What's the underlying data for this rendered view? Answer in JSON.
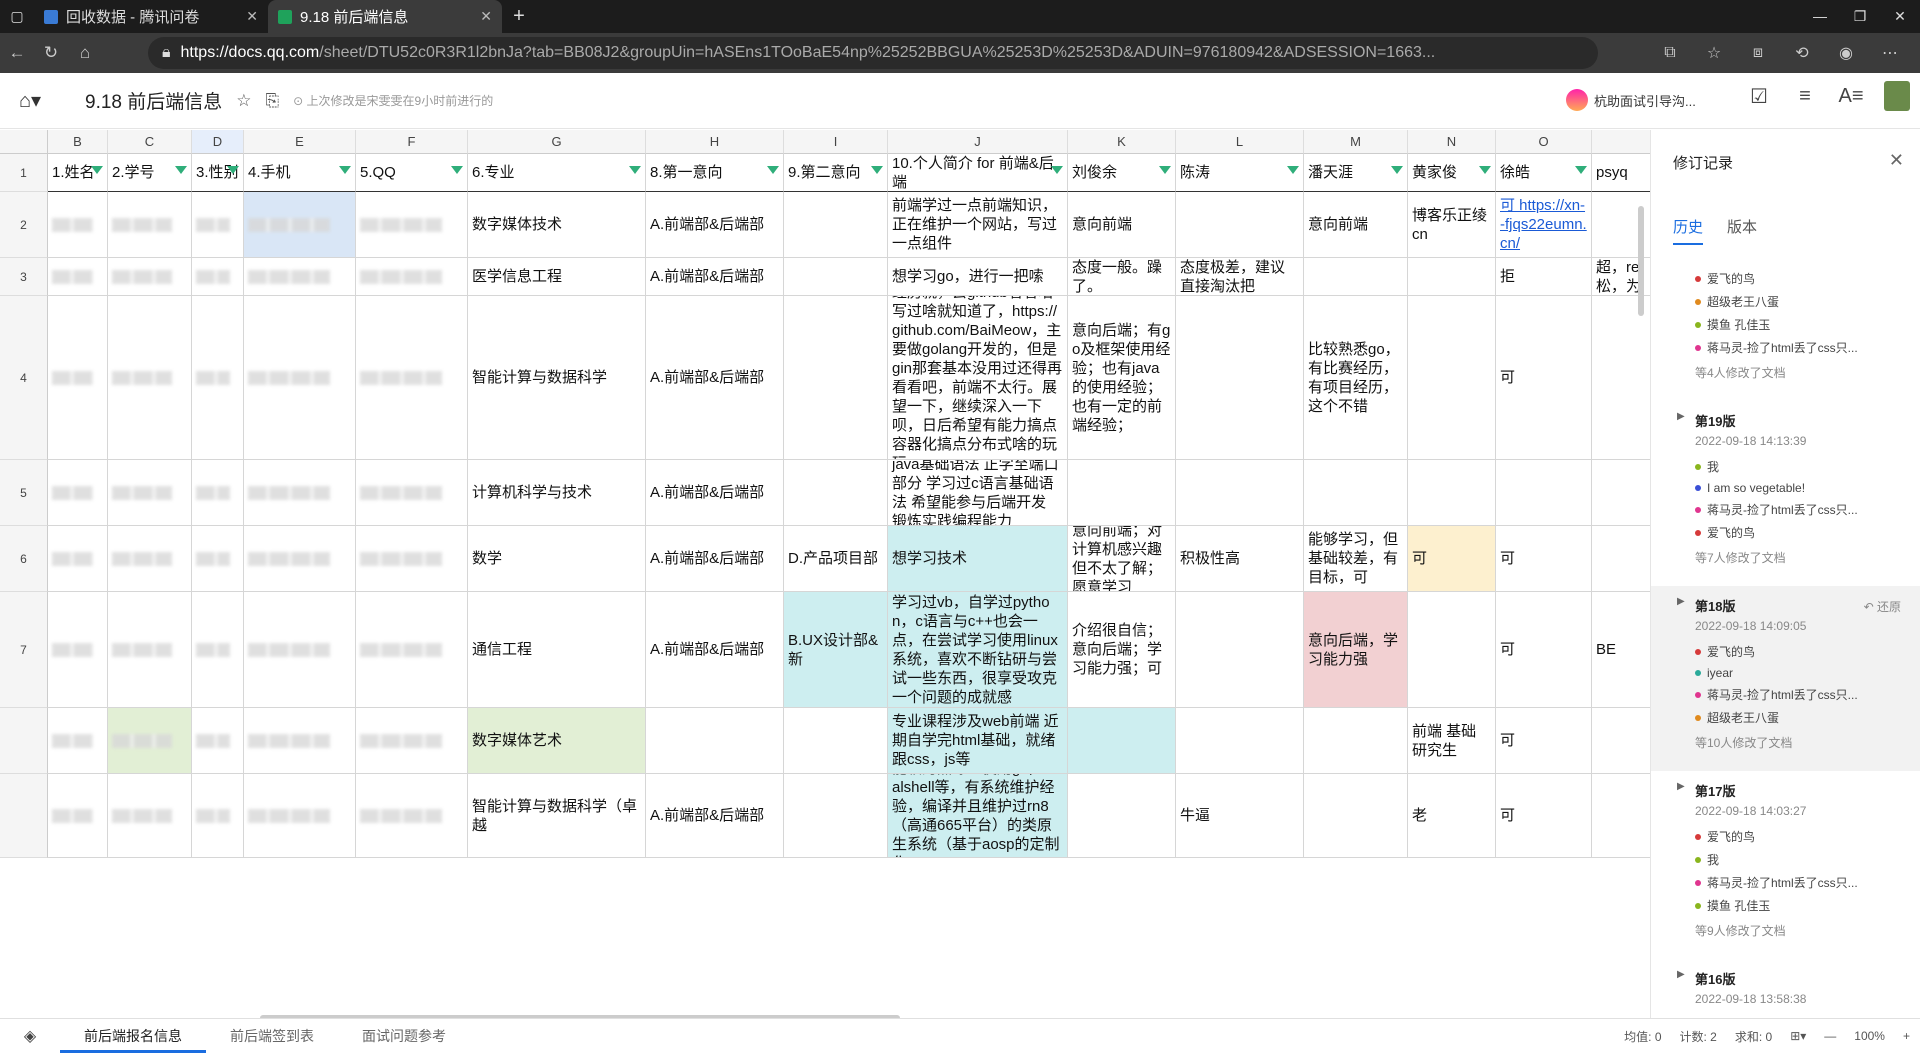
{
  "browser": {
    "tabs": [
      {
        "title": "回收数据 - 腾讯问卷",
        "color": "#3a7bd5"
      },
      {
        "title": "9.18 前后端信息",
        "color": "#1fa25b"
      }
    ],
    "url_host": "https://docs.qq.com",
    "url_rest": "/sheet/DTU52c0R3R1l2bnJa?tab=BB08J2&groupUin=hASEns1TOoBaE54np%25252BBGUA%25253D%25253D&ADUIN=976180942&ADSESSION=1663..."
  },
  "doc": {
    "title": "9.18 前后端信息",
    "status": "上次修改是宋雯雯在9小时前进行的",
    "collab_label": "杭助面试引导沟..."
  },
  "columns": [
    "B",
    "C",
    "D",
    "E",
    "F",
    "G",
    "H",
    "I",
    "J",
    "K",
    "L",
    "M",
    "N",
    "O",
    ""
  ],
  "header_row": [
    "1.姓名",
    "2.学号",
    "3.性别",
    "4.手机",
    "5.QQ",
    "6.专业",
    "8.第一意向",
    "9.第二意向",
    "10.个人简介 for 前端&后端",
    "刘俊余",
    "陈涛",
    "潘天涯",
    "黄家俊",
    "徐皓",
    "psyq"
  ],
  "rows": [
    {
      "num": "2",
      "cells": [
        "",
        "",
        "",
        "",
        "",
        "数字媒体技术",
        "A.前端部&后端部",
        "",
        "前端学过一点前端知识，正在维护一个网站，写过一点组件",
        "意向前端",
        "",
        "意向前端",
        "博客乐正绫cn",
        "可 https://xn--fjqs22eumn.cn/",
        ""
      ]
    },
    {
      "num": "3",
      "cells": [
        "",
        "",
        "",
        "",
        "",
        "医学信息工程",
        "A.前端部&后端部",
        "",
        "想学习go，进行一把嗦",
        "态度一般。躁了。",
        "态度极差，建议直接淘汰把",
        "",
        "",
        "拒",
        "超，re松，为"
      ]
    },
    {
      "num": "4",
      "cells": [
        "",
        "",
        "",
        "",
        "",
        "智能计算与数据科学",
        "A.前端部&后端部",
        "",
        "经历就，去github看看咱写过啥就知道了，https://github.com/BaiMeow，主要做golang开发的，但是gin那套基本没用过还得再看看吧，前端不太行。展望一下，继续深入一下呗，日后希望有能力搞点容器化搞点分布式啥的玩玩。",
        "意向后端；有go及框架使用经验；也有java的使用经验；也有一定的前端经验；",
        "",
        "比较熟悉go，有比赛经历，有项目经历，这个不错",
        "",
        "可",
        ""
      ]
    },
    {
      "num": "5",
      "cells": [
        "",
        "",
        "",
        "",
        "",
        "计算机科学与技术",
        "A.前端部&后端部",
        "",
        "java基础语法 正学至端口部分 学习过c语言基础语法 希望能参与后端开发 锻炼实践编程能力",
        "",
        "",
        "",
        "",
        "",
        ""
      ]
    },
    {
      "num": "6",
      "cells": [
        "",
        "",
        "",
        "",
        "",
        "数学",
        "A.前端部&后端部",
        "D.产品项目部",
        "想学习技术",
        "意向前端；对计算机感兴趣但不太了解；愿意学习",
        "积极性高",
        "能够学习，但基础较差，有目标，可",
        "可",
        "可",
        ""
      ]
    },
    {
      "num": "7",
      "cells": [
        "",
        "",
        "",
        "",
        "",
        "通信工程",
        "A.前端部&后端部",
        "B.UX设计部&新",
        "学习过vb，自学过python，c语言与c++也会一点，在尝试学习使用linux系统，喜欢不断钻研与尝试一些东西，很享受攻克一个问题的成就感",
        "介绍很自信；意向后端；学习能力强；可",
        "",
        "意向后端，学习能力强",
        "",
        "可",
        "BE"
      ]
    },
    {
      "num": "",
      "cells": [
        "",
        "",
        "",
        "",
        "",
        "数字媒体艺术",
        "",
        "",
        "专业课程涉及web前端 近期自学完html基础，就绪跟css，js等",
        "",
        "",
        "",
        "前端 基础研究生",
        "可",
        ""
      ]
    },
    {
      "num": "",
      "cells": [
        "",
        "",
        "",
        "",
        "",
        "智能计算与数据科学（卓越",
        "A.前端部&后端部",
        "",
        "能较为熟练地使用git，finalshell等，有系统维护经验，编译并且维护过rn8（高通665平台）的类原生系统（基于aosp的定制化",
        "",
        "牛逼",
        "",
        "老",
        "可",
        ""
      ]
    }
  ],
  "side": {
    "title": "修订记录",
    "tab_history": "历史",
    "tab_version": "版本",
    "restore": "还原",
    "groups": [
      {
        "ver": "",
        "date": "",
        "items": [
          {
            "name": "爱飞的鸟",
            "color": "#d63a3a"
          },
          {
            "name": "超级老王八蛋",
            "color": "#e08a1e"
          },
          {
            "name": "摸鱼 孔佳玉",
            "color": "#8ab51e"
          },
          {
            "name": "蒋马灵-捡了html丢了css只...",
            "color": "#e0358f"
          }
        ],
        "more": "等4人修改了文档"
      },
      {
        "ver": "第19版",
        "date": "2022-09-18 14:13:39",
        "items": [
          {
            "name": "我",
            "color": "#8ab51e"
          },
          {
            "name": "I am so vegetable!",
            "color": "#3a4fd6"
          },
          {
            "name": "蒋马灵-捡了html丢了css只...",
            "color": "#e0358f"
          },
          {
            "name": "爱飞的鸟",
            "color": "#d63a3a"
          }
        ],
        "more": "等7人修改了文档"
      },
      {
        "ver": "第18版",
        "date": "2022-09-18 14:09:05",
        "items": [
          {
            "name": "爱飞的鸟",
            "color": "#d63a3a"
          },
          {
            "name": "iyear",
            "color": "#2aaa9a"
          },
          {
            "name": "蒋马灵-捡了html丢了css只...",
            "color": "#e0358f"
          },
          {
            "name": "超级老王八蛋",
            "color": "#e08a1e"
          }
        ],
        "more": "等10人修改了文档"
      },
      {
        "ver": "第17版",
        "date": "2022-09-18 14:03:27",
        "items": [
          {
            "name": "爱飞的鸟",
            "color": "#d63a3a"
          },
          {
            "name": "我",
            "color": "#8ab51e"
          },
          {
            "name": "蒋马灵-捡了html丢了css只...",
            "color": "#e0358f"
          },
          {
            "name": "摸鱼 孔佳玉",
            "color": "#8ab51e"
          }
        ],
        "more": "等9人修改了文档"
      },
      {
        "ver": "第16版",
        "date": "2022-09-18 13:58:38",
        "items": [],
        "more": ""
      }
    ]
  },
  "sheets": [
    "前后端报名信息",
    "前后端签到表",
    "面试问题参考"
  ],
  "stats": {
    "avg": "均值: 0",
    "count": "计数: 2",
    "sum": "求和: 0",
    "zoom": "100%"
  }
}
